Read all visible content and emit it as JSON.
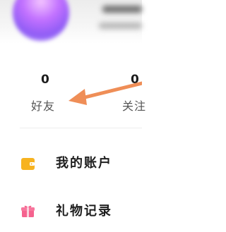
{
  "profile": {
    "avatar_icon": "user-avatar-icon"
  },
  "stats": [
    {
      "count": "0",
      "label": "好友"
    },
    {
      "count": "0",
      "label": "关注"
    }
  ],
  "annotation": {
    "arrow_color": "#ef8e57"
  },
  "menu": [
    {
      "label": "我的账户",
      "icon": "wallet-icon",
      "icon_color": "#f7b320"
    },
    {
      "label": "礼物记录",
      "icon": "gift-icon",
      "icon_color": "#f5628e"
    }
  ]
}
